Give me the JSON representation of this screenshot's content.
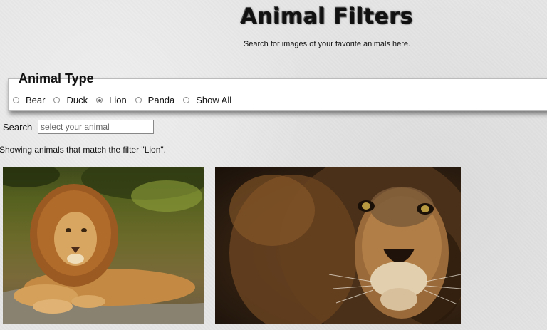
{
  "header": {
    "title": "Animal Filters",
    "subtitle": "Search for images of your favorite animals here."
  },
  "filter": {
    "legend": "Animal Type",
    "options": [
      {
        "label": "Bear",
        "checked": false
      },
      {
        "label": "Duck",
        "checked": false
      },
      {
        "label": "Lion",
        "checked": true
      },
      {
        "label": "Panda",
        "checked": false
      },
      {
        "label": "Show All",
        "checked": false
      }
    ]
  },
  "search": {
    "label": "Search",
    "placeholder": "select your animal",
    "value": ""
  },
  "status_text": "Showing animals that match the filter \"Lion\".",
  "gallery": {
    "images": [
      "lion-photo",
      "lion-photo"
    ]
  },
  "colors": {
    "page_background": "#e6e6e6",
    "panel_background": "#ffffff"
  }
}
